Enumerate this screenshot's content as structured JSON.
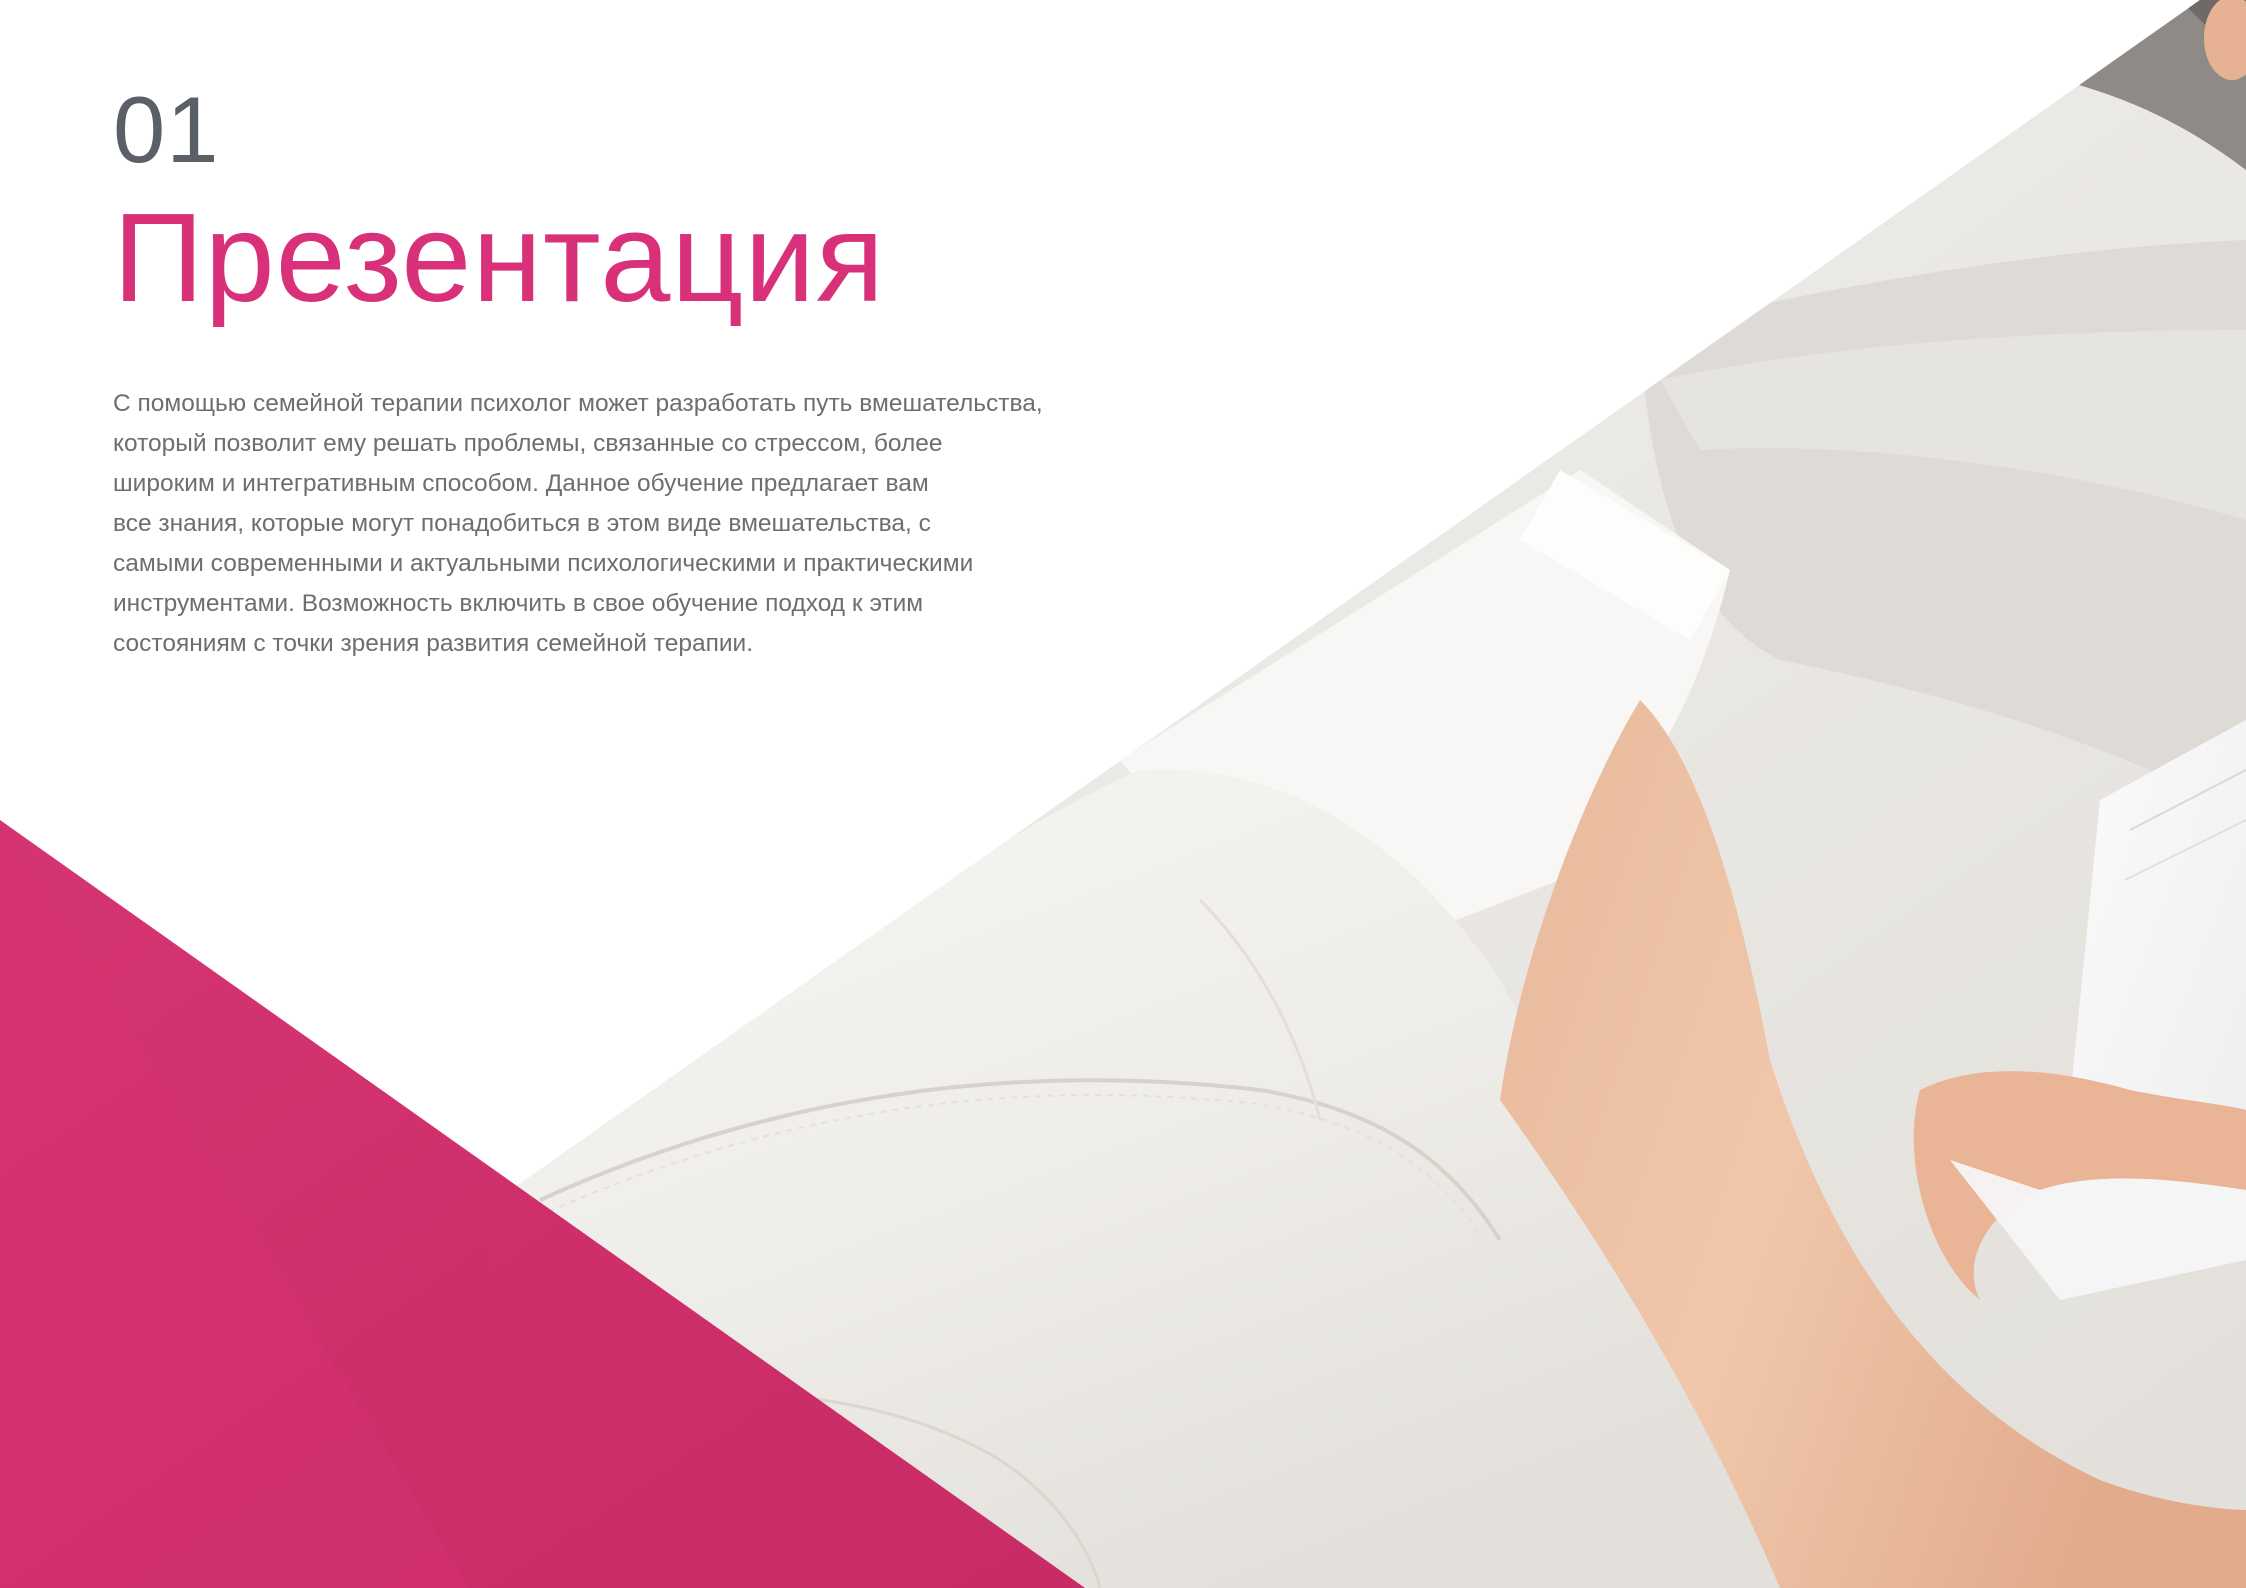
{
  "section": {
    "number": "01",
    "title": "Презентация"
  },
  "intro": {
    "lines": [
      "С помощью семейной терапии психолог может разработать путь вмешательства,",
      "который позволит ему решать проблемы, связанные со стрессом, более",
      "широким и интегративным способом. Данное обучение предлагает вам",
      "все знания, которые могут понадобиться в этом виде вмешательства, с",
      "самыми современными и актуальными психологическими и практическими",
      "инструментами. Возможность включить в свое обучение подход к этим",
      "состояниям с точки зрения развития семейной терапии."
    ]
  },
  "colors": {
    "accent": "#d8317a",
    "number": "#5b5f66",
    "body_text": "#6e6e6e"
  }
}
